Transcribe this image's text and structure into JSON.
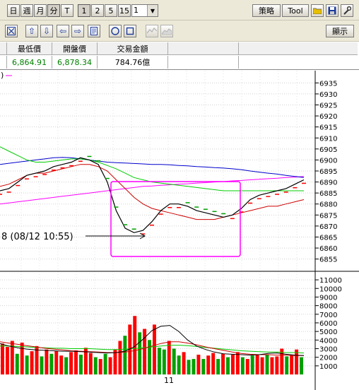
{
  "toolbar1": {
    "period_buttons": [
      "日",
      "週",
      "月",
      "分",
      "T"
    ],
    "minute_buttons": [
      "1",
      "2",
      "5",
      "15"
    ],
    "interval_value": "1",
    "strategy_label": "策略",
    "tool_label": "Tool"
  },
  "toolbar2": {
    "display_label": "顯示"
  },
  "quote": {
    "headers": [
      "最低價",
      "開盤價",
      "交易金額"
    ],
    "values": [
      "6,864.91",
      "6,878.34",
      "784.76億"
    ]
  },
  "price_panel": {
    "y_ticks": [
      "6935",
      "6930",
      "6925",
      "6920",
      "6915",
      "6910",
      "6905",
      "6900",
      "6895",
      "6890",
      "6885",
      "6880",
      "6875",
      "6870",
      "6865",
      "6860",
      "6855"
    ],
    "annotation": "8 (08/12 10:55)",
    "legend_fragment": ")"
  },
  "volume_panel": {
    "y_ticks": [
      "11000",
      "10000",
      "9000",
      "8000",
      "7000",
      "6000",
      "5000",
      "4000",
      "3000",
      "2000",
      "1000"
    ],
    "x_label": "11"
  },
  "colors": {
    "up": "#ff0000",
    "down": "#00a000",
    "ma_blue": "#0000cc",
    "ma_green": "#00cc00",
    "ma_red": "#cc0000",
    "ma_magenta": "#ff00ff",
    "price_line": "#000000",
    "highlight_box": "#ff00ff"
  },
  "chart_data": {
    "type": "line",
    "price_axis": {
      "ylim": [
        6852,
        6938
      ]
    },
    "index_line": [
      6886,
      6887,
      6890,
      6893,
      6894,
      6895,
      6897,
      6898,
      6899,
      6901,
      6900,
      6898,
      6890,
      6877,
      6869,
      6867,
      6868,
      6872,
      6877,
      6880,
      6880,
      6879,
      6877,
      6876,
      6875,
      6874,
      6875,
      6878,
      6882,
      6884,
      6885,
      6886,
      6887,
      6889,
      6891
    ],
    "ma_blue": [
      6898,
      6898.5,
      6899,
      6899.5,
      6900,
      6900.5,
      6901,
      6901.2,
      6901,
      6900.5,
      6900,
      6899.5,
      6899,
      6898.8,
      6898.6,
      6898.4,
      6898.2,
      6898,
      6898,
      6897.8,
      6897.5,
      6897.3,
      6897,
      6896.8,
      6896.5,
      6896.3,
      6896,
      6895.6,
      6895,
      6894.5,
      6894,
      6893.6,
      6893,
      6892.5,
      6892
    ],
    "ma_green": [
      6906,
      6904,
      6902,
      6900,
      6899,
      6899,
      6899.5,
      6900,
      6900.5,
      6900.5,
      6900,
      6899,
      6897.5,
      6896,
      6894,
      6892,
      6891,
      6890,
      6889.5,
      6889,
      6888.5,
      6888,
      6887.5,
      6887,
      6886.5,
      6886,
      6886,
      6886,
      6886,
      6886,
      6886,
      6886,
      6886,
      6886,
      6886
    ],
    "ma_red": [
      6888,
      6889,
      6891,
      6893,
      6894,
      6894,
      6895,
      6896,
      6897,
      6898,
      6898,
      6897,
      6895,
      6891,
      6887,
      6883,
      6880,
      6878,
      6877,
      6876,
      6875,
      6874,
      6873,
      6873,
      6873,
      6874,
      6875,
      6876,
      6877,
      6878,
      6879,
      6879,
      6880,
      6881,
      6882
    ],
    "ma_magenta": [
      6880,
      6880.5,
      6881,
      6881.5,
      6882,
      6882.5,
      6883,
      6883.5,
      6884,
      6884.5,
      6885,
      6885.5,
      6886,
      6886.5,
      6887,
      6887.5,
      6888,
      6888.2,
      6888.5,
      6888.7,
      6889,
      6889.2,
      6889.5,
      6889.7,
      6890,
      6890.2,
      6890.5,
      6890.7,
      6891,
      6891.2,
      6891.5,
      6891.7,
      6892,
      6892.2,
      6892.5
    ],
    "volume_axis": {
      "ylim": [
        0,
        11500
      ]
    },
    "volume_bars": [
      {
        "v": 3600,
        "c": "up"
      },
      {
        "v": 3200,
        "c": "up"
      },
      {
        "v": 3900,
        "c": "up"
      },
      {
        "v": 2400,
        "c": "down"
      },
      {
        "v": 3700,
        "c": "up"
      },
      {
        "v": 2200,
        "c": "down"
      },
      {
        "v": 2700,
        "c": "up"
      },
      {
        "v": 3300,
        "c": "up"
      },
      {
        "v": 2100,
        "c": "down"
      },
      {
        "v": 2900,
        "c": "up"
      },
      {
        "v": 2400,
        "c": "down"
      },
      {
        "v": 2700,
        "c": "up"
      },
      {
        "v": 2200,
        "c": "up"
      },
      {
        "v": 2000,
        "c": "down"
      },
      {
        "v": 2600,
        "c": "up"
      },
      {
        "v": 2800,
        "c": "up"
      },
      {
        "v": 2300,
        "c": "down"
      },
      {
        "v": 3100,
        "c": "up"
      },
      {
        "v": 2500,
        "c": "up"
      },
      {
        "v": 2000,
        "c": "down"
      },
      {
        "v": 1800,
        "c": "up"
      },
      {
        "v": 2400,
        "c": "down"
      },
      {
        "v": 2000,
        "c": "up"
      },
      {
        "v": 2900,
        "c": "up"
      },
      {
        "v": 3900,
        "c": "up"
      },
      {
        "v": 4500,
        "c": "down"
      },
      {
        "v": 5800,
        "c": "up"
      },
      {
        "v": 6800,
        "c": "up"
      },
      {
        "v": 4900,
        "c": "down"
      },
      {
        "v": 5300,
        "c": "up"
      },
      {
        "v": 4000,
        "c": "down"
      },
      {
        "v": 5800,
        "c": "up"
      },
      {
        "v": 3100,
        "c": "down"
      },
      {
        "v": 2900,
        "c": "down"
      },
      {
        "v": 3900,
        "c": "up"
      },
      {
        "v": 3000,
        "c": "down"
      },
      {
        "v": 2200,
        "c": "down"
      },
      {
        "v": 2600,
        "c": "up"
      },
      {
        "v": 1700,
        "c": "down"
      },
      {
        "v": 1800,
        "c": "down"
      },
      {
        "v": 2300,
        "c": "up"
      },
      {
        "v": 1800,
        "c": "down"
      },
      {
        "v": 2200,
        "c": "up"
      },
      {
        "v": 2500,
        "c": "up"
      },
      {
        "v": 1800,
        "c": "down"
      },
      {
        "v": 2400,
        "c": "up"
      },
      {
        "v": 2000,
        "c": "down"
      },
      {
        "v": 2300,
        "c": "up"
      },
      {
        "v": 2600,
        "c": "up"
      },
      {
        "v": 2000,
        "c": "down"
      },
      {
        "v": 1800,
        "c": "up"
      },
      {
        "v": 2200,
        "c": "down"
      },
      {
        "v": 2300,
        "c": "up"
      },
      {
        "v": 2000,
        "c": "up"
      },
      {
        "v": 2300,
        "c": "down"
      },
      {
        "v": 2000,
        "c": "up"
      },
      {
        "v": 2100,
        "c": "up"
      },
      {
        "v": 3000,
        "c": "up"
      },
      {
        "v": 2100,
        "c": "down"
      },
      {
        "v": 2200,
        "c": "up"
      },
      {
        "v": 2900,
        "c": "up"
      },
      {
        "v": 2000,
        "c": "down"
      }
    ],
    "volume_line": [
      3600,
      3300,
      3100,
      2950,
      2850,
      2800,
      2750,
      2700,
      2700,
      2650,
      2600,
      2550,
      2500,
      2550,
      2700,
      3200,
      4100,
      5100,
      5600,
      5700,
      5000,
      4000,
      3300,
      2900,
      2600,
      2400,
      2350,
      2300,
      2250,
      2300,
      2450,
      2500,
      2350,
      2250,
      2200
    ],
    "volume_ma_green": [
      3300,
      3300,
      3250,
      3200,
      3150,
      3100,
      3050,
      3050,
      3000,
      3000,
      3000,
      2950,
      2900,
      2900,
      2950,
      3000,
      3100,
      3200,
      3300,
      3400,
      3400,
      3350,
      3250,
      3150,
      3050,
      2950,
      2850,
      2750,
      2700,
      2650,
      2600,
      2600,
      2550,
      2550,
      2500
    ],
    "volume_ma_red": [
      3800,
      3650,
      3500,
      3350,
      3200,
      3050,
      2950,
      2850,
      2750,
      2700,
      2650,
      2600,
      2550,
      2550,
      2600,
      2750,
      3000,
      3300,
      3600,
      3800,
      3800,
      3650,
      3450,
      3200,
      3000,
      2800,
      2600,
      2450,
      2350,
      2300,
      2300,
      2250,
      2250,
      2200,
      2200
    ]
  }
}
